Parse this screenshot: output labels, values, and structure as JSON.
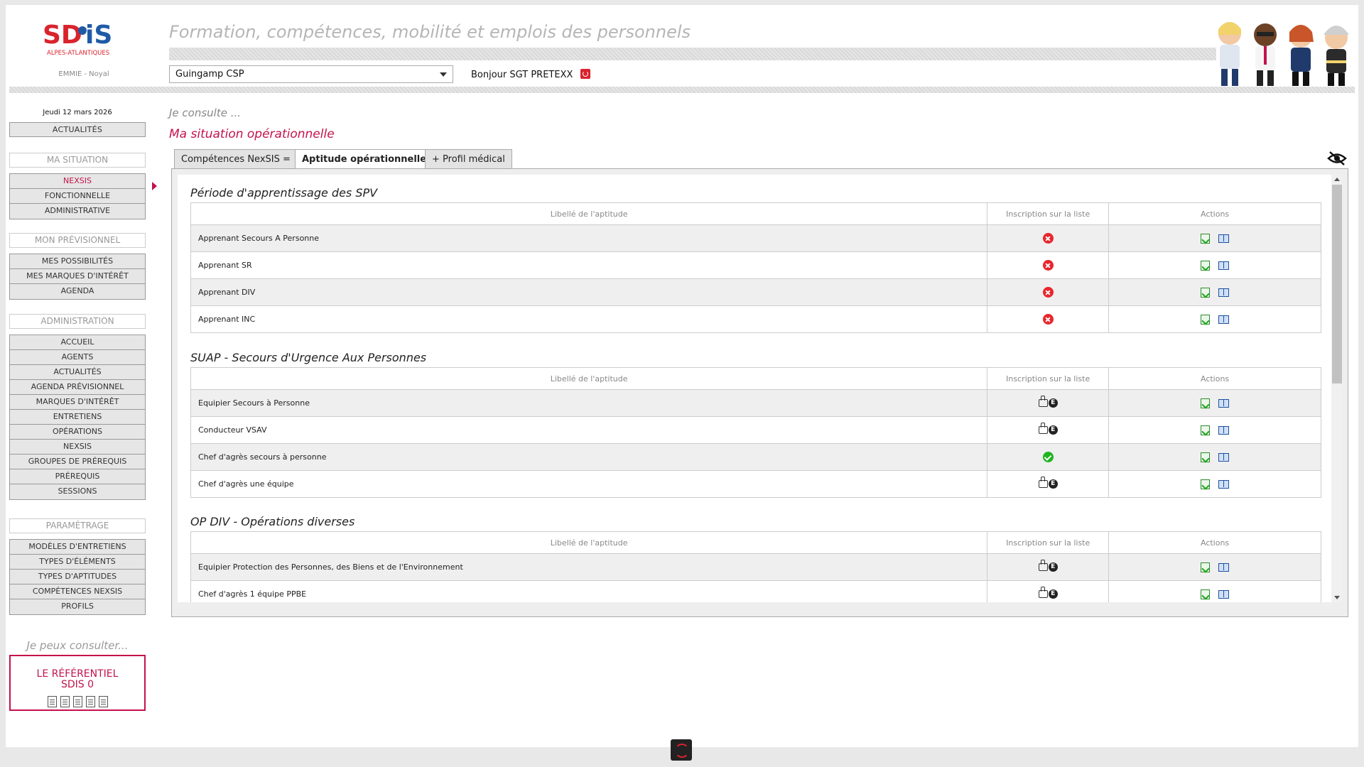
{
  "header": {
    "logo_text": "SDiS",
    "logo_subtitle": "ALPES-ATLANTIQUES",
    "location": "EMMIE - Noyal",
    "app_title": "Formation, compétences, mobilité et emplois des personnels",
    "center_select_value": "Guingamp CSP",
    "greeting": "Bonjour SGT PRETEXX"
  },
  "sidebar": {
    "date": "Jeudi 12 mars 2026",
    "actualites": "ACTUALITÉS",
    "ma_situation_title": "MA SITUATION",
    "ma_situation_items": [
      "NEXSIS",
      "FONCTIONNELLE",
      "ADMINISTRATIVE"
    ],
    "mon_previsionnel_title": "MON PRÉVISIONNEL",
    "mon_previsionnel_items": [
      "MES POSSIBILITÉS",
      "MES MARQUES D'INTÉRÊT",
      "AGENDA"
    ],
    "administration_title": "ADMINISTRATION",
    "administration_items": [
      "ACCUEIL",
      "AGENTS",
      "ACTUALITÉS",
      "AGENDA PRÉVISIONNEL",
      "MARQUES D'INTÉRÊT",
      "ENTRETIENS",
      "OPÉRATIONS",
      "NEXSIS",
      "GROUPES DE PRÉREQUIS",
      "PRÉREQUIS",
      "SESSIONS"
    ],
    "parametrage_title": "PARAMÉTRAGE",
    "parametrage_items": [
      "MODÈLES D'ENTRETIENS",
      "TYPES D'ÉLÉMENTS",
      "TYPES D'APTITUDES",
      "COMPÉTENCES NEXSIS",
      "PROFILS"
    ],
    "consult_label": "Je peux consulter...",
    "referentiel_label": "LE RÉFÉRENTIEL SDIS 0"
  },
  "main": {
    "je_consulte": "Je consulte ...",
    "page_title": "Ma situation opérationnelle",
    "tabs": [
      {
        "label": "Compétences NexSIS ="
      },
      {
        "label": "Aptitude opérationnelle"
      },
      {
        "label": "+ Profil médical"
      }
    ],
    "table_headers": {
      "libelle": "Libellé de l'aptitude",
      "inscription": "Inscription sur la liste",
      "actions": "Actions"
    },
    "sections": [
      {
        "title": "Période d'apprentissage des SPV",
        "rows": [
          {
            "label": "Apprenant Secours A Personne",
            "status": "no"
          },
          {
            "label": "Apprenant SR",
            "status": "no"
          },
          {
            "label": "Apprenant DIV",
            "status": "no"
          },
          {
            "label": "Apprenant INC",
            "status": "no"
          }
        ]
      },
      {
        "title": "SUAP - Secours d'Urgence Aux Personnes",
        "rows": [
          {
            "label": "Equipier Secours à Personne",
            "status": "e"
          },
          {
            "label": "Conducteur VSAV",
            "status": "e"
          },
          {
            "label": "Chef d'agrès secours à personne",
            "status": "ok"
          },
          {
            "label": "Chef d'agrès une équipe",
            "status": "e"
          }
        ]
      },
      {
        "title": "OP DIV - Opérations diverses",
        "rows": [
          {
            "label": "Equipier Protection des Personnes, des Biens et de l'Environnement",
            "status": "e"
          },
          {
            "label": "Chef d'agrès 1 équipe PPBE",
            "status": "e"
          }
        ]
      }
    ]
  },
  "icons": {
    "status_no": "red-cross-icon",
    "status_ok": "green-check-icon",
    "status_e": "thumb-e-icon",
    "edit": "edit-icon",
    "book": "book-icon"
  },
  "colors": {
    "accent": "#c4124b",
    "red": "#e8262d",
    "green": "#1fb51f"
  }
}
